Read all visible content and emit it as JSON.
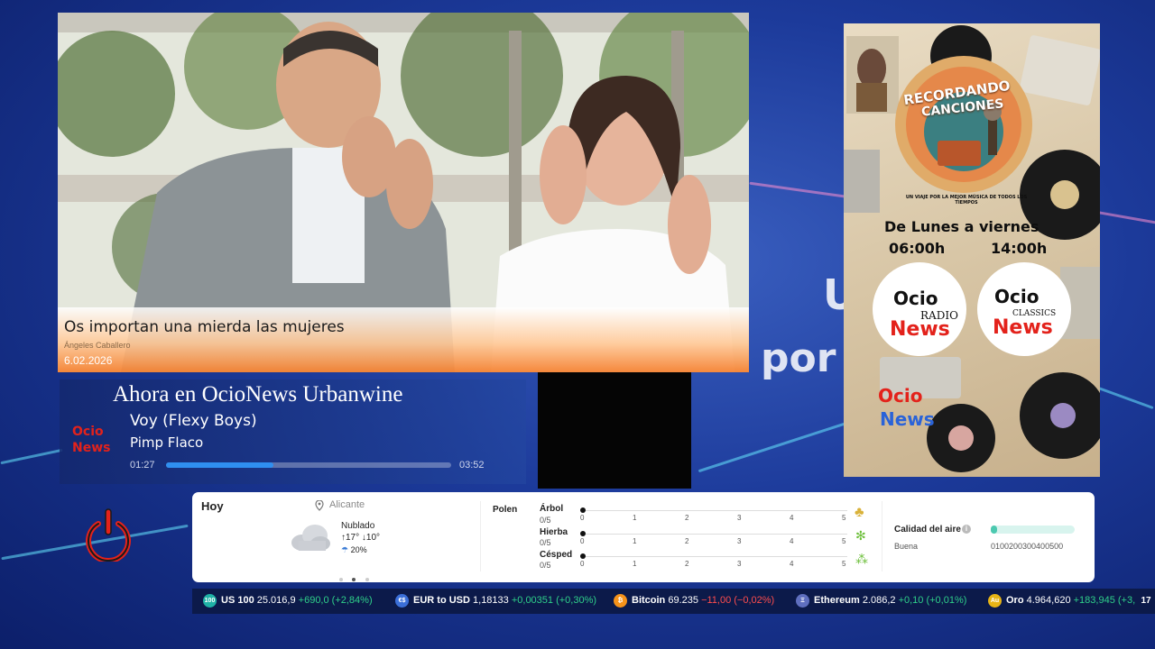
{
  "background": {
    "words": [
      "U",
      "por"
    ],
    "colors": {
      "primary": "#1c3a9a",
      "accent": "#f58a32",
      "brand_red": "#e3221b"
    }
  },
  "news": {
    "headline": "Os importan una mierda las mujeres",
    "author": "Ángeles Caballero",
    "date": "6.02.2026"
  },
  "now_playing": {
    "heading": "Ahora en OcioNews Urbanwine",
    "song": "Voy (Flexy Boys)",
    "artist": "Pimp Flaco",
    "elapsed": "01:27",
    "total": "03:52",
    "progress": 0.375,
    "logo_text": [
      "Ocio",
      "News"
    ]
  },
  "poster": {
    "badge_line1": "RECORDANDO",
    "badge_line2": "CANCIONES",
    "tagline": "UN VIAJE POR LA MEJOR MÚSICA DE TODOS LOS TIEMPOS",
    "schedule_title": "De Lunes a viernes",
    "time_start": "06:00h",
    "time_end": "14:00h",
    "logo_radio": {
      "top": "Ocio",
      "mid": "RADIO",
      "bottom": "News"
    },
    "logo_classics": {
      "top": "Ocio",
      "mid": "CLASSICS",
      "bottom": "News"
    },
    "logo_footer": {
      "top": "Ocio",
      "bottom": "News"
    }
  },
  "weather": {
    "day": "Hoy",
    "location": "Alicante",
    "condition": "Nublado",
    "high": "17°",
    "low": "10°",
    "rain": "20%",
    "pollen_label": "Polen",
    "pollen": [
      {
        "name": "Árbol",
        "score": "0/5"
      },
      {
        "name": "Hierba",
        "score": "0/5"
      },
      {
        "name": "Césped",
        "score": "0/5"
      }
    ],
    "scale": [
      "0",
      "1",
      "2",
      "3",
      "4",
      "5"
    ],
    "air_label": "Calidad del aire",
    "air_status": "Buena",
    "air_scale": "0100200300400500"
  },
  "ticker": [
    {
      "icon": "100",
      "name": "US 100",
      "price": "25.016,9",
      "change": "+690,0 (+2,84%)",
      "dir": "up",
      "color": "#1fb2a6"
    },
    {
      "icon": "€$",
      "name": "EUR to USD",
      "price": "1,18133",
      "change": "+0,00351 (+0,30%)",
      "dir": "up",
      "color": "#3b6fd8"
    },
    {
      "icon": "₿",
      "name": "Bitcoin",
      "price": "69.235",
      "change": "−11,00 (−0,02%)",
      "dir": "down",
      "color": "#f7931a"
    },
    {
      "icon": "Ξ",
      "name": "Ethereum",
      "price": "2.086,2",
      "change": "+0,10 (+0,01%)",
      "dir": "up",
      "color": "#5f6fbf"
    },
    {
      "icon": "Au",
      "name": "Oro",
      "price": "4.964,620",
      "change": "+183,945 (+3,",
      "dir": "up",
      "color": "#e7b416"
    }
  ],
  "ticker_brand": "17"
}
